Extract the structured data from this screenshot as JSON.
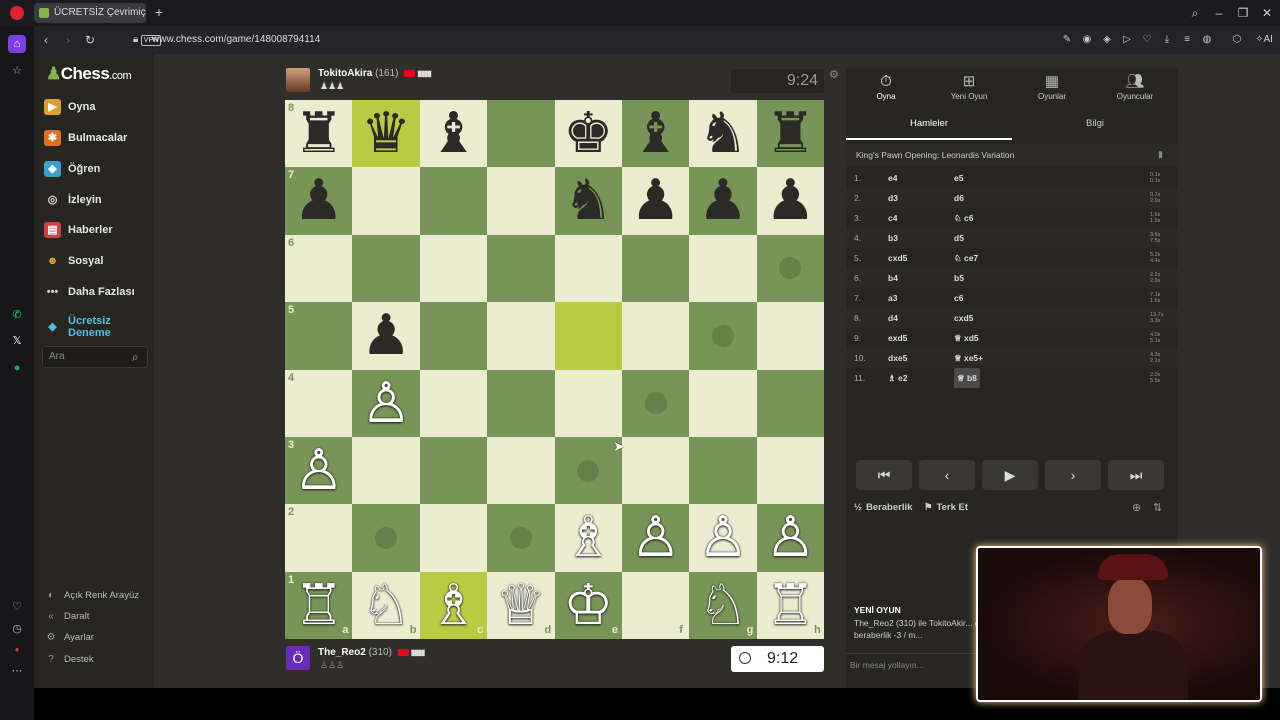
{
  "browser": {
    "tab_title": "ÜCRETSİZ Çevrimiçi Satranç",
    "url": "www.chess.com/game/148008794114",
    "vpn_label": "VPN"
  },
  "nav": {
    "logo": "Chess",
    "logo_suffix": ".com",
    "items": [
      {
        "label": "Oyna",
        "icon": "play-icon",
        "color": "#e0a030"
      },
      {
        "label": "Bulmacalar",
        "icon": "puzzle-icon",
        "color": "#e07020"
      },
      {
        "label": "Öğren",
        "icon": "learn-icon",
        "color": "#3aa0d0"
      },
      {
        "label": "İzleyin",
        "icon": "watch-icon",
        "color": "#bbbbbb"
      },
      {
        "label": "Haberler",
        "icon": "news-icon",
        "color": "#d04040"
      },
      {
        "label": "Sosyal",
        "icon": "social-icon",
        "color": "#e0a030"
      },
      {
        "label": "Daha Fazlası",
        "icon": "more-icon",
        "color": "#bbbbbb"
      }
    ],
    "trial_label": "Ücretsiz Deneme",
    "search_placeholder": "Ara",
    "bottom": [
      {
        "label": "Açık Renk Arayüz",
        "icon": "theme-icon"
      },
      {
        "label": "Daralt",
        "icon": "collapse-icon"
      },
      {
        "label": "Ayarlar",
        "icon": "settings-icon"
      },
      {
        "label": "Destek",
        "icon": "help-icon"
      }
    ]
  },
  "players": {
    "top": {
      "name": "TokitoAkira",
      "rating": "(161)",
      "clock": "9:24"
    },
    "bottom": {
      "name": "The_Reo2",
      "rating": "(310)",
      "clock": "9:12",
      "avatar_letter": "Ö"
    }
  },
  "board": {
    "pieces": [
      {
        "sq": "a8",
        "p": "♜",
        "c": "b"
      },
      {
        "sq": "b8",
        "p": "♛",
        "c": "b"
      },
      {
        "sq": "c8",
        "p": "♝",
        "c": "b"
      },
      {
        "sq": "e8",
        "p": "♚",
        "c": "b"
      },
      {
        "sq": "f8",
        "p": "♝",
        "c": "b"
      },
      {
        "sq": "g8",
        "p": "♞",
        "c": "b"
      },
      {
        "sq": "h8",
        "p": "♜",
        "c": "b"
      },
      {
        "sq": "a7",
        "p": "♟",
        "c": "b"
      },
      {
        "sq": "e7",
        "p": "♞",
        "c": "b"
      },
      {
        "sq": "f7",
        "p": "♟",
        "c": "b"
      },
      {
        "sq": "g7",
        "p": "♟",
        "c": "b"
      },
      {
        "sq": "h7",
        "p": "♟",
        "c": "b"
      },
      {
        "sq": "b5",
        "p": "♟",
        "c": "b"
      },
      {
        "sq": "b4",
        "p": "♙",
        "c": "w"
      },
      {
        "sq": "a3",
        "p": "♙",
        "c": "w"
      },
      {
        "sq": "e2",
        "p": "♗",
        "c": "w"
      },
      {
        "sq": "f2",
        "p": "♙",
        "c": "w"
      },
      {
        "sq": "g2",
        "p": "♙",
        "c": "w"
      },
      {
        "sq": "h2",
        "p": "♙",
        "c": "w"
      },
      {
        "sq": "a1",
        "p": "♖",
        "c": "w"
      },
      {
        "sq": "b1",
        "p": "♘",
        "c": "w"
      },
      {
        "sq": "c1",
        "p": "♗",
        "c": "w"
      },
      {
        "sq": "d1",
        "p": "♕",
        "c": "w"
      },
      {
        "sq": "e1",
        "p": "♔",
        "c": "w"
      },
      {
        "sq": "g1",
        "p": "♘",
        "c": "w"
      },
      {
        "sq": "h1",
        "p": "♖",
        "c": "w"
      }
    ],
    "highlights": [
      "b8",
      "e5",
      "c1"
    ],
    "move_dots": [
      "h6",
      "g5",
      "f4",
      "e3",
      "b2",
      "d2"
    ],
    "rank_labels": [
      "8",
      "7",
      "6",
      "5",
      "4",
      "3",
      "2",
      "1"
    ],
    "file_labels": [
      "a",
      "b",
      "c",
      "d",
      "e",
      "f",
      "g",
      "h"
    ]
  },
  "panel": {
    "tabs": [
      {
        "label": "Oyna",
        "icon": "stopwatch-icon"
      },
      {
        "label": "Yeni Oyun",
        "icon": "plus-icon"
      },
      {
        "label": "Oyunlar",
        "icon": "board-icon"
      },
      {
        "label": "Oyuncular",
        "icon": "players-icon"
      }
    ],
    "subtabs": [
      "Hamleler",
      "Bilgi"
    ],
    "opening": "King's Pawn Opening: Leonardis Variation",
    "moves": [
      {
        "n": "1.",
        "w": "e4",
        "b": "e5",
        "tw": "0.1s",
        "tb": "0.1s"
      },
      {
        "n": "2.",
        "w": "d3",
        "b": "d6",
        "tw": "0.7s",
        "tb": "2.0s"
      },
      {
        "n": "3.",
        "w": "c4",
        "b": "♘ c6",
        "tw": "1.6s",
        "tb": "1.5s"
      },
      {
        "n": "4.",
        "w": "b3",
        "b": "d5",
        "tw": "3.6s",
        "tb": "7.5s"
      },
      {
        "n": "5.",
        "w": "cxd5",
        "b": "♘ ce7",
        "tw": "5.2s",
        "tb": "4.4s"
      },
      {
        "n": "6.",
        "w": "b4",
        "b": "b5",
        "tw": "2.2s",
        "tb": "2.9s"
      },
      {
        "n": "7.",
        "w": "a3",
        "b": "c6",
        "tw": "7.1s",
        "tb": "1.6s"
      },
      {
        "n": "8.",
        "w": "d4",
        "b": "cxd5",
        "tw": "13.7s",
        "tb": "3.3s"
      },
      {
        "n": "9.",
        "w": "exd5",
        "b": "♕ xd5",
        "tw": "4.0s",
        "tb": "5.1s"
      },
      {
        "n": "10.",
        "w": "dxe5",
        "b": "♕ xe5+",
        "tw": "4.3s",
        "tb": "2.1s"
      },
      {
        "n": "11.",
        "w": "♗ e2",
        "b": "♕ b8",
        "tw": "2.0s",
        "tb": "5.5s"
      }
    ],
    "draw_label": "Beraberlik",
    "resign_label": "Terk Et",
    "newgame_title": "YENİ OYUN",
    "newgame_text": "The_Reo2 (310) ile TokitoAkir... galibiyet +5 / beraberlik -3 / m...",
    "chat_placeholder": "Bir mesaj yollayın..."
  }
}
